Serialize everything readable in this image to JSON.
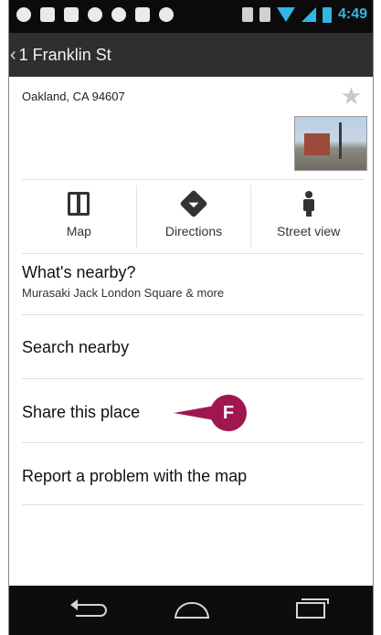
{
  "status_bar": {
    "time": "4:49",
    "left_icons": [
      "location-icon",
      "sim-icon",
      "download-icon",
      "chat-icon",
      "gmail-icon",
      "image-icon",
      "photo-icon"
    ],
    "right_icons": [
      "bluetooth-icon",
      "rotate-icon",
      "wifi-icon",
      "signal-icon",
      "battery-icon"
    ],
    "accent": "#33b5e5"
  },
  "action_bar": {
    "back_glyph": "‹",
    "title": "1 Franklin St"
  },
  "place": {
    "address": "Oakland, CA 94607",
    "star_glyph": "★"
  },
  "actions": [
    {
      "label": "Map",
      "icon": "map-icon"
    },
    {
      "label": "Directions",
      "icon": "directions-icon"
    },
    {
      "label": "Street view",
      "icon": "street-view-icon"
    }
  ],
  "list": {
    "nearby_title": "What's nearby?",
    "nearby_sub": "Murasaki Jack London Square & more",
    "search_nearby": "Search nearby",
    "share": "Share this place",
    "report": "Report a problem with the map"
  },
  "callout": {
    "label": "F",
    "color": "#a0174f"
  },
  "nav_bar": {
    "buttons": [
      "back-icon",
      "home-icon",
      "recent-apps-icon"
    ]
  }
}
